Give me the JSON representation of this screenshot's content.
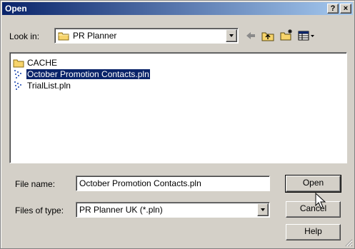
{
  "window": {
    "title": "Open",
    "help_button": "?",
    "close_button": "×"
  },
  "look_in": {
    "label": "Look in:",
    "value": "PR Planner"
  },
  "toolbar": {
    "icons": [
      "back-arrow-icon",
      "up-one-level-icon",
      "new-folder-icon",
      "view-menu-icon"
    ]
  },
  "files": [
    {
      "name": "CACHE",
      "type": "folder",
      "selected": false
    },
    {
      "name": "October Promotion Contacts.pln",
      "type": "file",
      "selected": true
    },
    {
      "name": "TrialList.pln",
      "type": "file",
      "selected": false
    }
  ],
  "file_name": {
    "label": "File name:",
    "value": "October Promotion Contacts.pln"
  },
  "files_of_type": {
    "label": "Files of type:",
    "value": "PR Planner UK (*.pln)"
  },
  "buttons": {
    "open": "Open",
    "cancel": "Cancel",
    "help": "Help"
  },
  "colors": {
    "title_start": "#0a246a",
    "title_end": "#a6caf0",
    "face": "#d4d0c8",
    "selection": "#0a246a"
  }
}
